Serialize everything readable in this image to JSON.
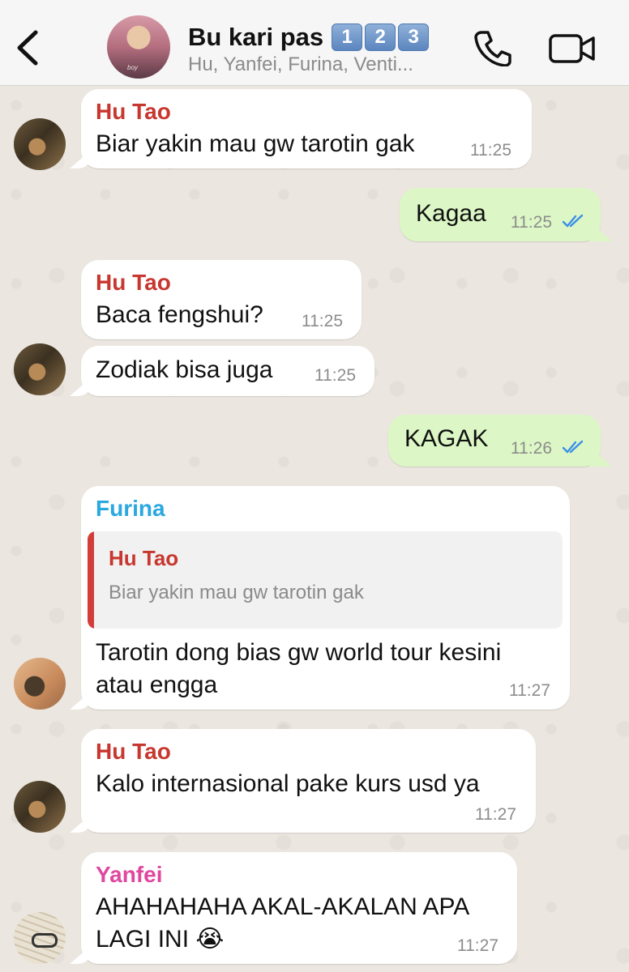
{
  "header": {
    "back_icon": "chevron-left-icon",
    "group_name": "Bu kari pas",
    "badges": [
      "1",
      "2",
      "3"
    ],
    "members": "Hu, Yanfei, Furina, Venti...",
    "avatar_caption": "boy",
    "call_icon": "phone-icon",
    "video_icon": "video-camera-icon"
  },
  "colors": {
    "hu_tao": "#c8372f",
    "furina": "#2aa8df",
    "yanfei": "#e0489f",
    "outgoing_bubble": "#dcf7c5",
    "read_ticks": "#3b8ee8"
  },
  "messages": [
    {
      "sender": "Hu Tao",
      "text": "Biar yakin mau gw tarotin gak",
      "time": "11:25"
    },
    {
      "text": "Kagaa",
      "time": "11:25",
      "status": "read"
    },
    {
      "sender": "Hu Tao",
      "text": "Baca fengshui?",
      "time": "11:25"
    },
    {
      "text": "Zodiak bisa juga",
      "time": "11:25"
    },
    {
      "text": "KAGAK",
      "time": "11:26",
      "status": "read"
    },
    {
      "sender": "Furina",
      "reply_to": {
        "sender": "Hu Tao",
        "text": "Biar yakin mau gw tarotin gak"
      },
      "line1": "Tarotin dong bias gw world tour kesini",
      "line2": "atau engga",
      "time": "11:27"
    },
    {
      "sender": "Hu Tao",
      "text": "Kalo internasional pake kurs usd ya",
      "time": "11:27"
    },
    {
      "sender": "Yanfei",
      "line1": "AHAHAHAHA AKAL-AKALAN APA",
      "line2": "LAGI INI 😭",
      "time": "11:27"
    }
  ]
}
